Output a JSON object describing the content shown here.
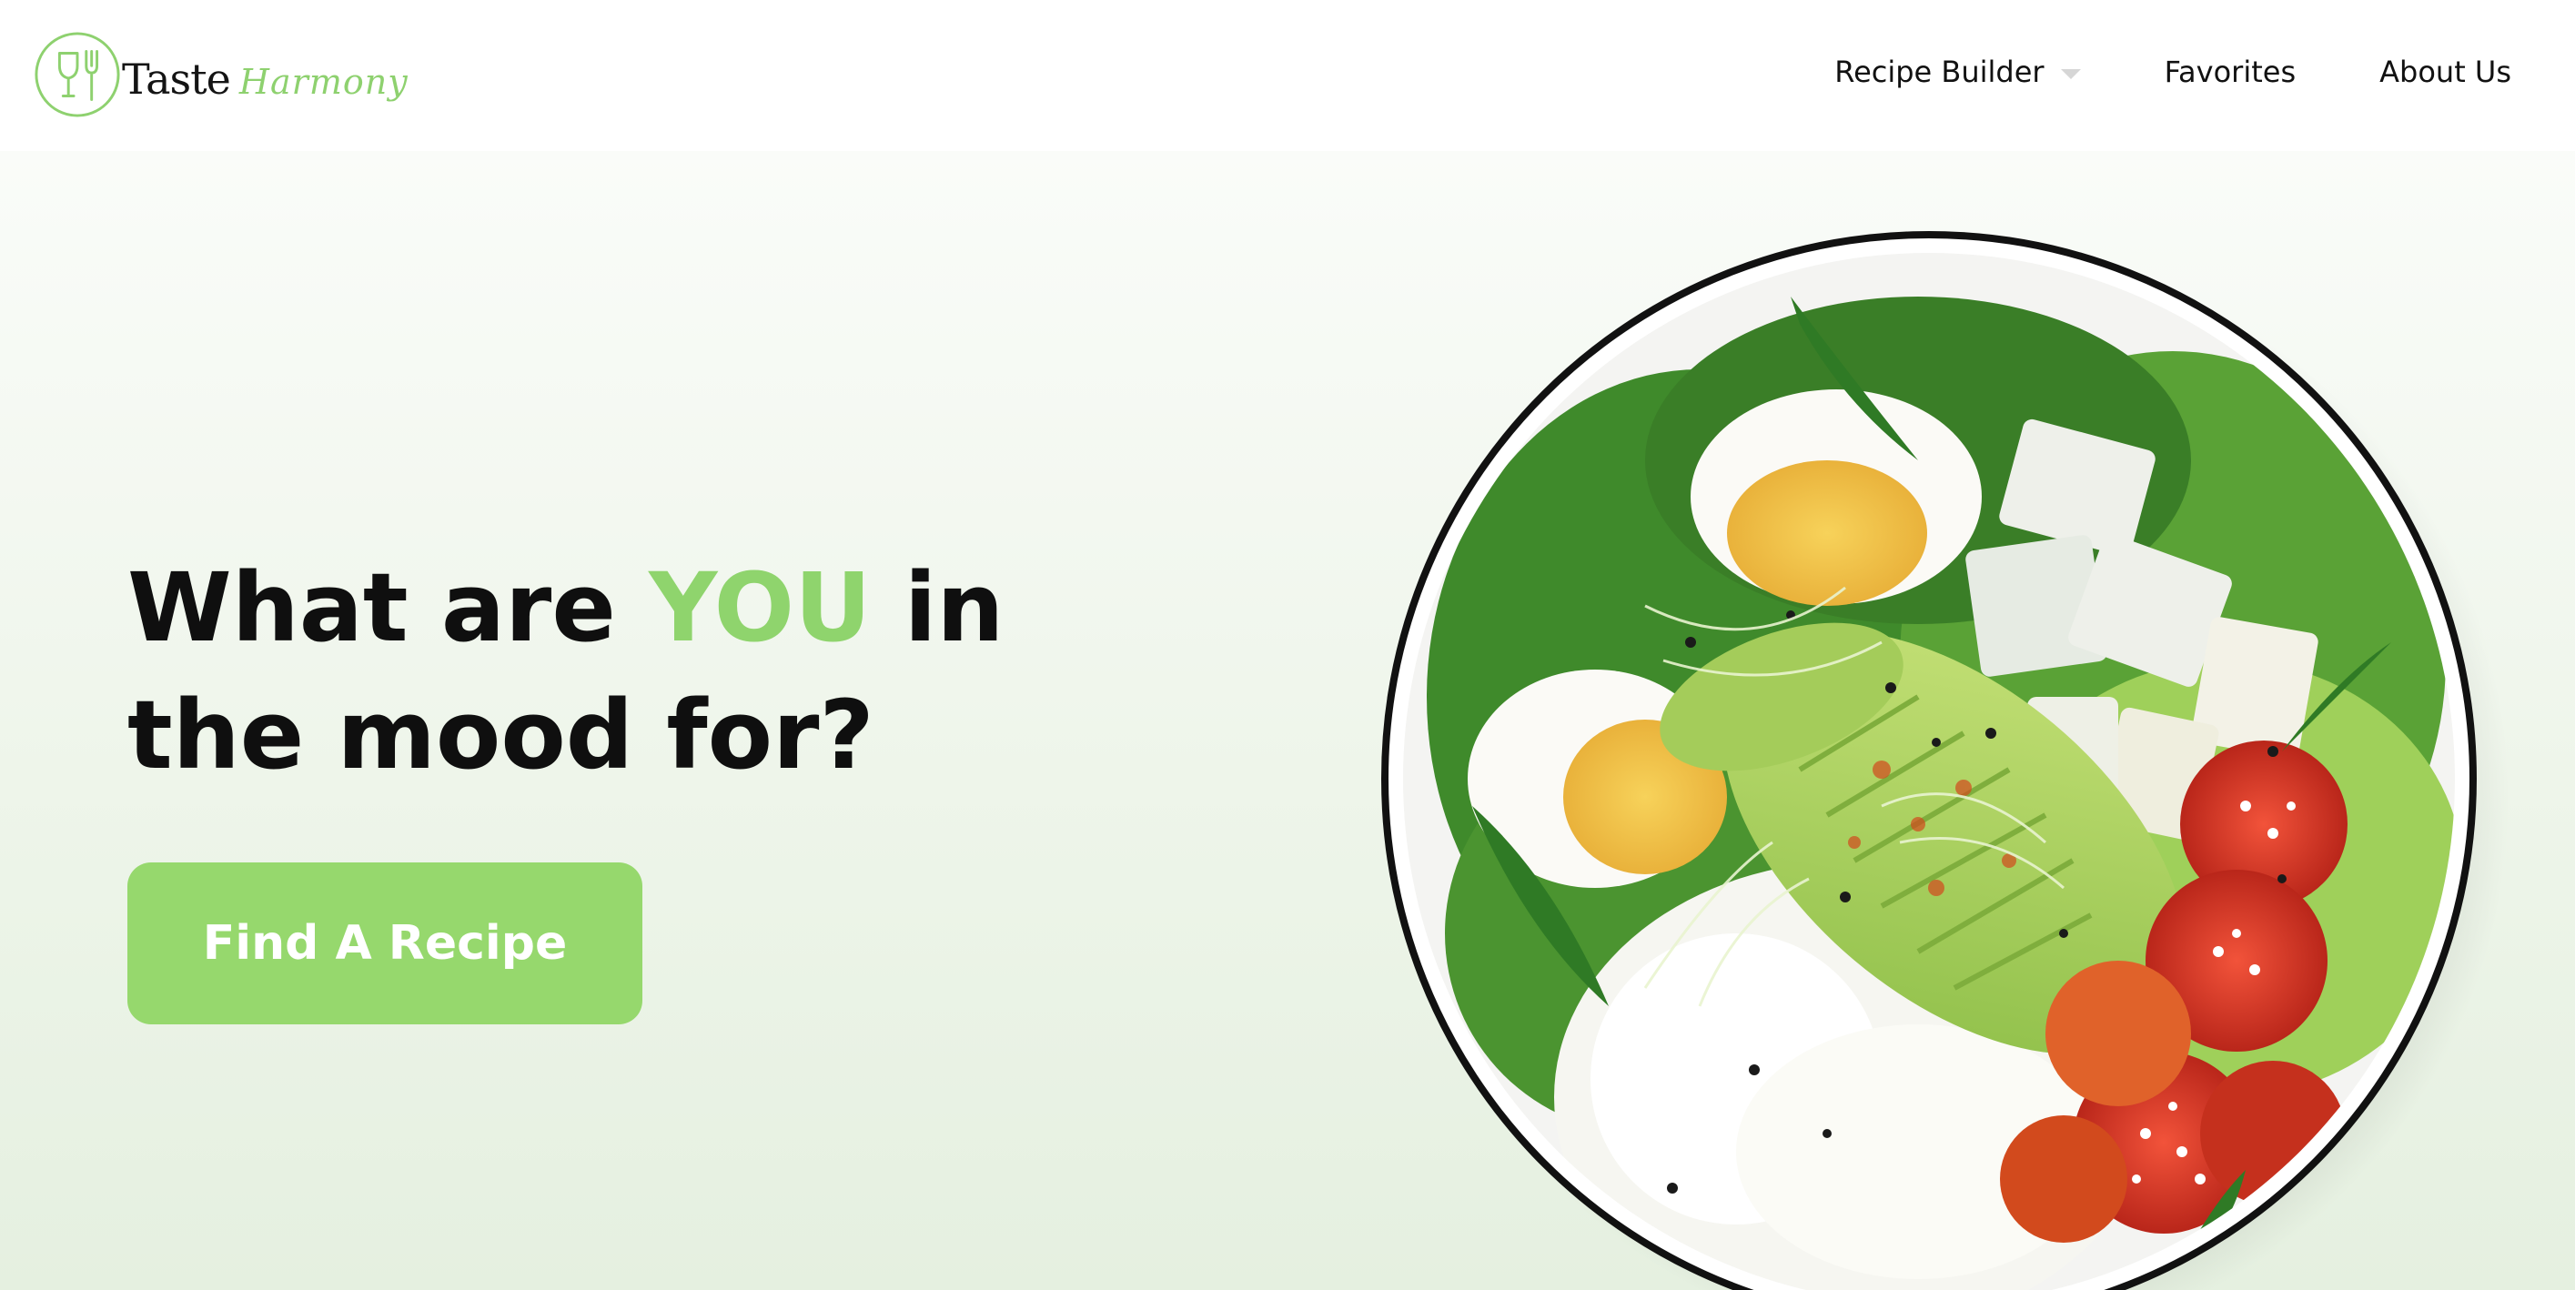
{
  "brand": {
    "word1": "Taste",
    "word2": "Harmony",
    "accent_color": "#8ed16f"
  },
  "nav": {
    "items": [
      {
        "label": "Recipe Builder",
        "has_dropdown": true
      },
      {
        "label": "Favorites",
        "has_dropdown": false
      },
      {
        "label": "About Us",
        "has_dropdown": false
      }
    ]
  },
  "hero": {
    "title_part1": "What are ",
    "title_accent": "YOU",
    "title_part2": " in the mood for?",
    "cta_label": "Find A Recipe",
    "cta_color": "#96d86d"
  },
  "image": {
    "icon": "salad-bowl-photo"
  }
}
